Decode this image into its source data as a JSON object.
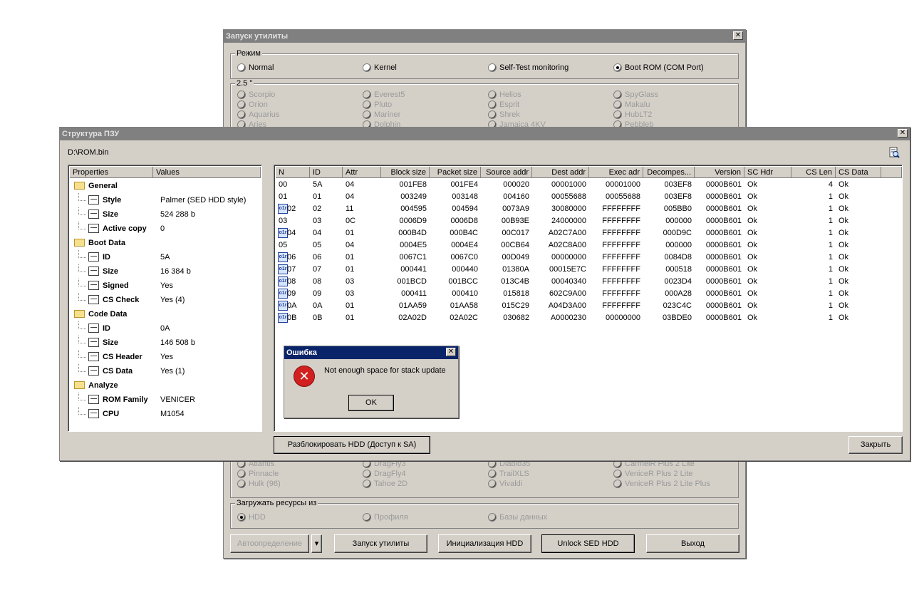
{
  "launcher": {
    "title": "Запуск утилиты",
    "close": "✕",
    "mode": {
      "label": "Режим",
      "options": [
        "Normal",
        "Kernel",
        "Self-Test monitoring",
        "Boot ROM (COM Port)"
      ],
      "selected": "Boot ROM (COM Port)"
    },
    "family": {
      "label": "2.5 \"",
      "top_rows": [
        [
          "Scorpio",
          "Everest5",
          "Helios",
          "SpyGlass"
        ],
        [
          "Orion",
          "Pluto",
          "Esprit",
          "Makalu"
        ],
        [
          "Aquarius",
          "Mariner",
          "Shrek",
          "HubLT2"
        ],
        [
          "Aries",
          "Dolphin",
          "Jamaica 4KV",
          "Pebbleb"
        ]
      ],
      "bottom_rows": [
        [
          "Atlantis",
          "DragFly3",
          "Diablo35",
          "CarmelR Plus 2 Lite"
        ],
        [
          "Pinnacle",
          "DragFly4",
          "TrailXLS",
          "VeniceR Plus 2 Lite"
        ],
        [
          "Hulk (96)",
          "Tahoe 2D",
          "Vivaldi",
          "VeniceR Plus 2 Lite Plus"
        ]
      ]
    },
    "resources": {
      "label": "Загружать ресурсы из",
      "options": [
        "HDD",
        "Профиля",
        "Базы данных"
      ],
      "selected": "HDD"
    },
    "buttons": {
      "autodetect": "Автоопределение",
      "autodetect_arrow": "▾",
      "run": "Запуск утилиты",
      "init": "Инициализация HDD",
      "unlock": "Unlock SED HDD",
      "exit": "Выход"
    }
  },
  "rom": {
    "title": "Структура ПЗУ",
    "close": "✕",
    "path": "D:\\ROM.bin",
    "props": {
      "headers": [
        "Properties",
        "Values"
      ],
      "rows": [
        {
          "kind": "group",
          "name": "General",
          "value": ""
        },
        {
          "kind": "item",
          "name": "Style",
          "value": "Palmer (SED HDD style)"
        },
        {
          "kind": "item",
          "name": "Size",
          "value": "524 288 b"
        },
        {
          "kind": "item",
          "name": "Active copy",
          "value": "0"
        },
        {
          "kind": "group",
          "name": "Boot Data",
          "value": ""
        },
        {
          "kind": "item",
          "name": "ID",
          "value": "5A"
        },
        {
          "kind": "item",
          "name": "Size",
          "value": "16 384 b"
        },
        {
          "kind": "item",
          "name": "Signed",
          "value": "Yes"
        },
        {
          "kind": "item",
          "name": "CS Check",
          "value": "Yes (4)"
        },
        {
          "kind": "group",
          "name": "Code Data",
          "value": ""
        },
        {
          "kind": "item",
          "name": "ID",
          "value": "0A"
        },
        {
          "kind": "item",
          "name": "Size",
          "value": "146 508 b"
        },
        {
          "kind": "item",
          "name": "CS Header",
          "value": "Yes"
        },
        {
          "kind": "item",
          "name": "CS Data",
          "value": "Yes (1)"
        },
        {
          "kind": "group",
          "name": "Analyze",
          "value": ""
        },
        {
          "kind": "item",
          "name": "ROM Family",
          "value": "VENICER"
        },
        {
          "kind": "item",
          "name": "CPU",
          "value": "M1054"
        }
      ]
    },
    "table": {
      "headers": [
        "N",
        "ID",
        "Attr",
        "Block size",
        "Packet size",
        "Source addr",
        "Dest addr",
        "Exec adr",
        "Decompes...",
        "Version",
        "SC Hdr",
        "CS Len",
        "CS Data"
      ],
      "row_icon_text": "o1r",
      "rows": [
        {
          "icon": false,
          "cells": [
            "00",
            "5A",
            "04",
            "001FE8",
            "001FE4",
            "000020",
            "00001000",
            "00001000",
            "003EF8",
            "0000B601",
            "Ok",
            "4",
            "Ok"
          ]
        },
        {
          "icon": false,
          "cells": [
            "01",
            "01",
            "04",
            "003249",
            "003148",
            "004160",
            "00055688",
            "00055688",
            "003EF8",
            "0000B601",
            "Ok",
            "1",
            "Ok"
          ]
        },
        {
          "icon": true,
          "cells": [
            "02",
            "02",
            "11",
            "004595",
            "004594",
            "0073A9",
            "30080000",
            "FFFFFFFF",
            "005BB0",
            "0000B601",
            "Ok",
            "1",
            "Ok"
          ]
        },
        {
          "icon": false,
          "cells": [
            "03",
            "03",
            "0C",
            "0006D9",
            "0006D8",
            "00B93E",
            "24000000",
            "FFFFFFFF",
            "000000",
            "0000B601",
            "Ok",
            "1",
            "Ok"
          ]
        },
        {
          "icon": true,
          "cells": [
            "04",
            "04",
            "01",
            "000B4D",
            "000B4C",
            "00C017",
            "A02C7A00",
            "FFFFFFFF",
            "000D9C",
            "0000B601",
            "Ok",
            "1",
            "Ok"
          ]
        },
        {
          "icon": false,
          "cells": [
            "05",
            "05",
            "04",
            "0004E5",
            "0004E4",
            "00CB64",
            "A02C8A00",
            "FFFFFFFF",
            "000000",
            "0000B601",
            "Ok",
            "1",
            "Ok"
          ]
        },
        {
          "icon": true,
          "cells": [
            "06",
            "06",
            "01",
            "0067C1",
            "0067C0",
            "00D049",
            "00000000",
            "FFFFFFFF",
            "0084D8",
            "0000B601",
            "Ok",
            "1",
            "Ok"
          ]
        },
        {
          "icon": true,
          "cells": [
            "07",
            "07",
            "01",
            "000441",
            "000440",
            "01380A",
            "00015E7C",
            "FFFFFFFF",
            "000518",
            "0000B601",
            "Ok",
            "1",
            "Ok"
          ]
        },
        {
          "icon": true,
          "cells": [
            "08",
            "08",
            "03",
            "001BCD",
            "001BCC",
            "013C4B",
            "00040340",
            "FFFFFFFF",
            "0023D4",
            "0000B601",
            "Ok",
            "1",
            "Ok"
          ]
        },
        {
          "icon": true,
          "cells": [
            "09",
            "09",
            "03",
            "000411",
            "000410",
            "015818",
            "602C9A00",
            "FFFFFFFF",
            "000A28",
            "0000B601",
            "Ok",
            "1",
            "Ok"
          ]
        },
        {
          "icon": true,
          "cells": [
            "0A",
            "0A",
            "01",
            "01AA59",
            "01AA58",
            "015C29",
            "A04D3A00",
            "FFFFFFFF",
            "023C4C",
            "0000B601",
            "Ok",
            "1",
            "Ok"
          ]
        },
        {
          "icon": true,
          "cells": [
            "0B",
            "0B",
            "01",
            "02A02D",
            "02A02C",
            "030682",
            "A0000230",
            "00000000",
            "03BDE0",
            "0000B601",
            "Ok",
            "1",
            "Ok"
          ]
        }
      ]
    },
    "buttons": {
      "unlock_sa": "Разблокировать HDD (Доступ к SA)",
      "close": "Закрыть"
    }
  },
  "error": {
    "title": "Ошибка",
    "close": "✕",
    "icon": "error-icon",
    "icon_glyph": "✕",
    "message": "Not enough space for stack update",
    "ok": "OK"
  }
}
